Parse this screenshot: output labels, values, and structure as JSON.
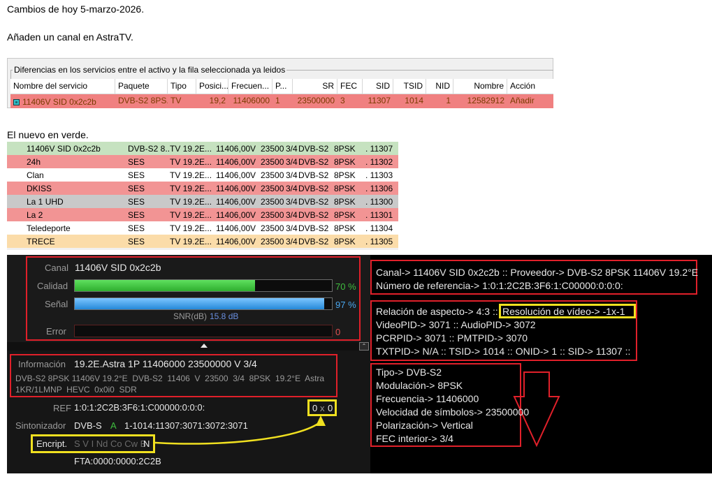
{
  "heading": "Cambios de hoy 5-marzo-2026.",
  "subheading": "Añaden un canal en AstraTV.",
  "diff_panel": {
    "legend": "Diferencias en los servicios entre el activo y la fila seleccionada ya leidos",
    "headers": [
      "Nombre del servicio",
      "Paquete",
      "Tipo",
      "Posici...",
      "Frecuen...",
      "P...",
      "SR",
      "FEC",
      "SID",
      "TSID",
      "NID",
      "Nombre",
      "Acción"
    ],
    "row": [
      "11406V SID 0x2c2b",
      "DVB-S2 8PS...",
      "TV",
      "19,2",
      "11406000",
      "1",
      "23500000",
      "3",
      "11307",
      "1014",
      "1",
      "12582912",
      "Añadir"
    ]
  },
  "new_label": "El nuevo en verde.",
  "channels": [
    {
      "name": "11406V SID 0x2c2b",
      "pkg": "DVB-S2 8...",
      "tv": "TV 19.2E...",
      "freq": "11406,00",
      "pol": "V",
      "sr": "23500",
      "fec": "3/4",
      "sys": "DVB-S2",
      "mod": "8PSK",
      "sid": ". 11307",
      "color": "green"
    },
    {
      "name": "24h",
      "pkg": "SES",
      "tv": "TV 19.2E...",
      "freq": "11406,00",
      "pol": "V",
      "sr": "23500",
      "fec": "3/4",
      "sys": "DVB-S2",
      "mod": "8PSK",
      "sid": ". 11302",
      "color": "red"
    },
    {
      "name": "Clan",
      "pkg": "SES",
      "tv": "TV 19.2E...",
      "freq": "11406,00",
      "pol": "V",
      "sr": "23500",
      "fec": "3/4",
      "sys": "DVB-S2",
      "mod": "8PSK",
      "sid": ". 11303",
      "color": "white"
    },
    {
      "name": "DKISS",
      "pkg": "SES",
      "tv": "TV 19.2E...",
      "freq": "11406,00",
      "pol": "V",
      "sr": "23500",
      "fec": "3/4",
      "sys": "DVB-S2",
      "mod": "8PSK",
      "sid": ". 11306",
      "color": "red"
    },
    {
      "name": "La 1 UHD",
      "pkg": "SES",
      "tv": "TV 19.2E...",
      "freq": "11406,00",
      "pol": "V",
      "sr": "23500",
      "fec": "3/4",
      "sys": "DVB-S2",
      "mod": "8PSK",
      "sid": ". 11300",
      "color": "gray"
    },
    {
      "name": "La 2",
      "pkg": "SES",
      "tv": "TV 19.2E...",
      "freq": "11406,00",
      "pol": "V",
      "sr": "23500",
      "fec": "3/4",
      "sys": "DVB-S2",
      "mod": "8PSK",
      "sid": ". 11301",
      "color": "red"
    },
    {
      "name": "Teledeporte",
      "pkg": "SES",
      "tv": "TV 19.2E...",
      "freq": "11406,00",
      "pol": "V",
      "sr": "23500",
      "fec": "3/4",
      "sys": "DVB-S2",
      "mod": "8PSK",
      "sid": ". 11304",
      "color": "white"
    },
    {
      "name": "TRECE",
      "pkg": "SES",
      "tv": "TV 19.2E...",
      "freq": "11406,00",
      "pol": "V",
      "sr": "23500",
      "fec": "3/4",
      "sys": "DVB-S2",
      "mod": "8PSK",
      "sid": ". 11305",
      "color": "orange"
    }
  ],
  "signal": {
    "canal_label": "Canal",
    "canal_value": "11406V SID 0x2c2b",
    "calidad_label": "Calidad",
    "calidad_pct": "70 %",
    "calidad_level": 0.7,
    "senal_label": "Señal",
    "senal_pct": "97 %",
    "senal_level": 0.97,
    "snr_label": "SNR(dB)",
    "snr_value": "15.8 dB",
    "error_label": "Error",
    "error_value": "0"
  },
  "info": {
    "label": "Información",
    "title": "19.2E.Astra 1P 11406000 23500000 V 3/4",
    "detail1": "DVB-S2 8PSK 11406V 19.2°E  DVB-S2  11406  V  23500  3/4  8PSK  19.2°E  Astra",
    "detail2": "1KR/1LMNP  HEVC  0x0i0  SDR",
    "ref_label": "REF",
    "ref_value": "1:0:1:2C2B:3F6:1:C00000:0:0:0:",
    "res_a": "0",
    "res_x": "x",
    "res_b": "0",
    "sint_label": "Sintonizador",
    "sint_value": "DVB-S",
    "sint_a": "A",
    "sint_pids": "1-1014:11307:3071:3072:3071",
    "encript_label": "Encript.",
    "encript_flags": "S V I Nd Co Cw B",
    "encript_active": "N",
    "fta": "FTA:0000:0000:2C2B"
  },
  "right": {
    "box1_line1": "Canal-> 11406V SID 0x2c2b :: Proveedor-> DVB-S2 8PSK 11406V 19.2°E",
    "box1_line2": "Número de referencia-> 1:0:1:2C2B:3F6:1:C00000:0:0:0:",
    "aspect": "Relación de aspecto-> 4:3 :: ",
    "resolution": "Resolución de vídeo-> -1x-1",
    "pids1": "VideoPID-> 3071 :: AudioPID-> 3072",
    "pids2": "PCRPID-> 3071 :: PMTPID-> 3070",
    "pids3": "TXTPID-> N/A :: TSID-> 1014 :: ONID-> 1 :: SID-> 11307 ::",
    "tipo": "Tipo-> DVB-S2",
    "modulacion": "Modulación-> 8PSK",
    "frecuencia": "Frecuencia-> 11406000",
    "velocidad": "Velocidad de símbolos-> 23500000",
    "polarizacion": "Polarización-> Vertical",
    "fec": "FEC interior-> 3/4"
  },
  "colors": {
    "green": "#c6e2c0",
    "red": "#f29494",
    "white": "#ffffff",
    "gray": "#c9c9c9",
    "orange": "#fbdca9",
    "quality_bar": "#3fbf3f",
    "signal_bar": "#2f9fe8",
    "annot_red": "#e0202a",
    "annot_yellow": "#f0e020"
  }
}
